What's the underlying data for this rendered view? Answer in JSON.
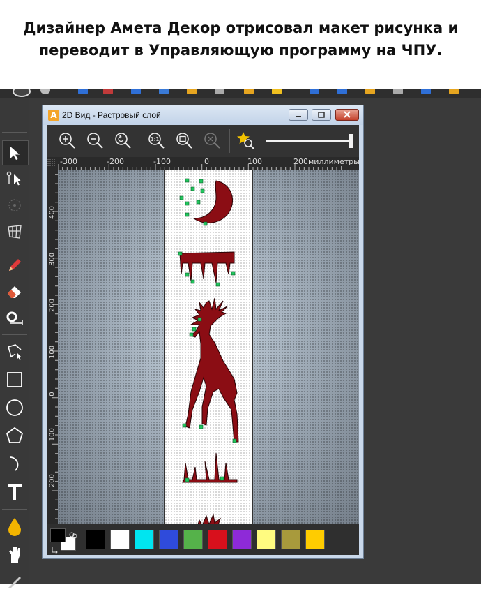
{
  "caption": {
    "line1": "Дизайнер Амета Декор отрисовал макет рисунка и",
    "line2": "переводит в Управляющую программу на ЧПУ."
  },
  "window": {
    "title": "2D Вид - Растровый слой",
    "app_icon_letter": "A"
  },
  "toolbar": {
    "icons": [
      "zoom-in-icon",
      "zoom-out-icon",
      "zoom-previous-icon",
      "zoom-1to1-icon",
      "zoom-fit-icon",
      "zoom-selection-icon",
      "zoom-star-icon"
    ],
    "one_to_one_label": "1:1",
    "zoom_level": 1.0
  },
  "ruler": {
    "h_ticks": [
      "-300",
      "-200",
      "-100",
      "0",
      "100",
      "200"
    ],
    "units": "миллиметры",
    "v_ticks": [
      "400",
      "300",
      "200",
      "100",
      "0",
      "-100",
      "-200"
    ]
  },
  "left_tools": [
    "select-arrow-icon",
    "node-edit-icon",
    "transform-icon",
    "distort-icon",
    "pen-icon",
    "eraser-icon",
    "measure-icon",
    "polyline-icon",
    "rectangle-icon",
    "circle-icon",
    "polygon-icon",
    "arc-icon",
    "text-icon",
    "fill-drop-icon",
    "smudge-icon"
  ],
  "palette": {
    "current_fg": "#000000",
    "current_bg": "#ffffff",
    "colors": [
      "#000000",
      "#ffffff",
      "#00e5f0",
      "#2f4bdb",
      "#55b24a",
      "#d8101c",
      "#8e2ad8",
      "#fffb80",
      "#a89a3c",
      "#ffcc00"
    ]
  },
  "design": {
    "fill_color": "#8b0d14",
    "node_color": "#22c55e"
  }
}
